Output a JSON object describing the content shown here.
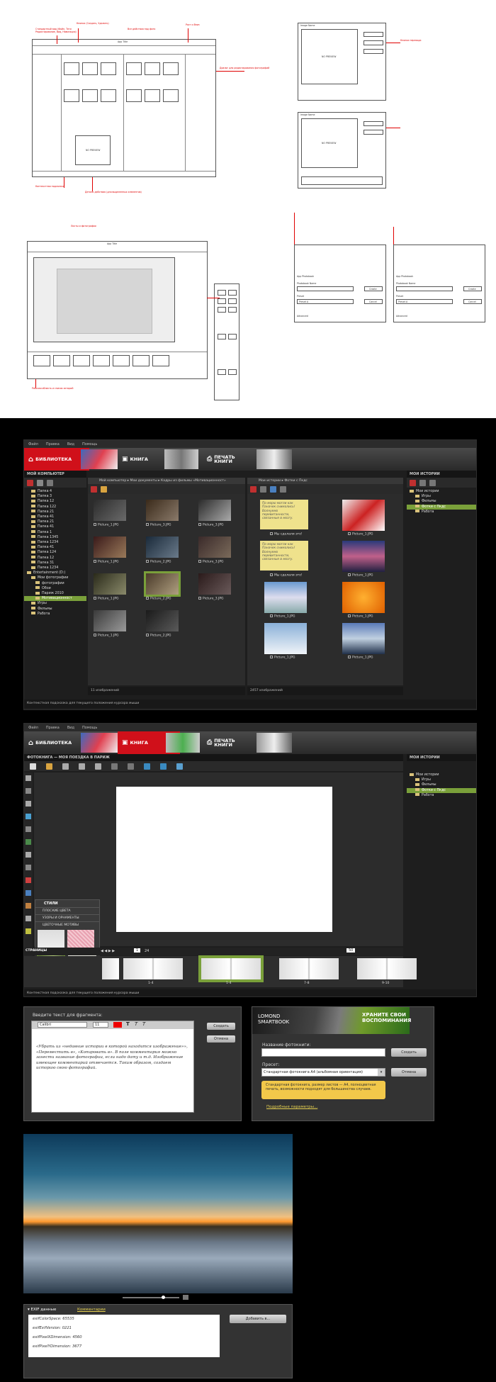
{
  "wireframe": {
    "app_title": "App Title",
    "image_name": "Image Name",
    "photo_name": "Photo Name",
    "no_preview": "NO PREVIEW",
    "picture": "picture",
    "thumb_label": "Picture_1.jpg",
    "dialog_title": "App Photobook",
    "photobook_name": "Photobook Name",
    "create": "Create",
    "cancel": "Cancel",
    "preset": "Preset",
    "preset_value": "Preset A",
    "extra": "Advanced",
    "notes": [
      "Стандартный вид (Файл, Теги\nРедактирование, Вид, Навигация)",
      "Кнопки (Создать, Удалить)",
      "Все действия над фото",
      "Диалог для редактирования фотографий",
      "Кнопки перехода",
      "Рост и Вниз",
      "Контекстная подсказка",
      "Детали действия (для выделенных элементов)",
      "Листы и фотографии",
      "Рабочая область и список историй"
    ]
  },
  "app1": {
    "menu": [
      "Файл",
      "Правка",
      "Вид",
      "Помощь"
    ],
    "tabs": [
      {
        "label": "БИБЛИОТЕКА"
      },
      {
        "label": "КНИГА"
      },
      {
        "label": "ПЕЧАТЬ КНИГИ"
      }
    ],
    "left_header": "МОЙ КОМПЬЮТЕР",
    "right_header": "МОИ ИСТОРИИ",
    "tree": [
      "Папка 4",
      "Папка 3",
      "Папка 12",
      "Папка 122",
      "Папка 21",
      "Папка 41",
      "Папка 21",
      "Папка 41",
      "Папка 1",
      "Папка 1345",
      "Папка 1234",
      "Папка 41",
      "Папка 124",
      "Папка 12",
      "Папка 31",
      "Папка 1234",
      "Entertainment (D:)",
      "Мои фотографии",
      "фотографии",
      "Обои",
      "Париж 2010",
      "Мотивационност",
      "Игры",
      "Фильмы",
      "Работа"
    ],
    "tree_selected": 21,
    "stories": [
      "Мои истории",
      "Игры",
      "Фильмы",
      "Фотки с Пкдс",
      "Работа"
    ],
    "stories_selected": 3,
    "breadcrumb_left": "Мой компьютер  ▸  Мои документы  ▸  Кадры из фильмы «Мотивационност»",
    "breadcrumb_right": "Мои истории  ▸  Фотки с Пкдс",
    "thumbs_left": [
      "Picture_1.JPG",
      "Picture_3.JPG",
      "Picture_3.JPG",
      "Picture_1.JPG",
      "Picture_2.JPG",
      "Picture_3.JPG",
      "Picture_1.JPG",
      "Picture_2.JPG",
      "Picture_3.JPG",
      "Picture_1.JPG",
      "Picture_2.JPG"
    ],
    "thumbs_right": [
      "Мы сделали это!",
      "Picture_1.JPG",
      "Мы сделали это!",
      "Picture_1.JPG",
      "Picture_1.JPG",
      "Picture_1.JPG",
      "Picture_1.JPG",
      "Picture_1.JPG"
    ],
    "note_text": "По морю могли как Паначек снимались! Волнуемо перевитанности, связанные в мозгу.",
    "count_left": "11 изображений",
    "count_right": "2457 изображений",
    "status": "Контекстная подсказка для текущего положения курсора мыши"
  },
  "app2": {
    "menu": [
      "Файл",
      "Правка",
      "Вид",
      "Помощь"
    ],
    "title": "ФОТОКНИГА — МОЯ ПОЕЗДКА В ПАРИЖ",
    "right_header": "МОИ ИСТОРИИ",
    "stories": [
      "Мои истории",
      "Игры",
      "Фильмы",
      "Фотки с Пкдс",
      "Работа"
    ],
    "stories_selected": 3,
    "styles_header": "СТИЛИ",
    "styles": [
      "ПЛОСКИЕ ЦВЕТА",
      "УЗОРЫ И ОРНАМЕНТЫ",
      "ЦВЕТОЧНЫЕ МОТИВЫ"
    ],
    "pages_label": "СТРАНИЦЫ",
    "page_num": "1",
    "page_total": "24",
    "zoom": "50",
    "spreads": [
      "1-4",
      "1-4",
      "7-8",
      "9-10"
    ],
    "status": "Контекстная подсказка для текущего положения курсора мыши"
  },
  "textdlg": {
    "label": "Введите текст для фрагмента:",
    "font": "Calibri",
    "size": "11",
    "create": "Создать",
    "cancel": "Отмена",
    "body": "«Убрать из «недавние истории в которой находится изображение»», «Переместить в», «Копировать в». В поле комментария можно занести название фотографии, если надо дату и т.д. Изображение имеющее комментарий отмечается. Таким образом, создаем историю свою фотографий."
  },
  "bookdlg": {
    "banner_brand": "LOMOND SMARTBOOK",
    "banner_slogan": "ХРАНИТЕ СВОИ ВОСПОМИНАНИЯ",
    "name_label": "Название фотокниги:",
    "create": "Создать",
    "preset_label": "Пресет:",
    "preset_value": "Стандартная фотокнига А4 (альбомная ориентация)",
    "cancel": "Отмена",
    "hint": "Стандартная фотокнига, размер листов — А4, полноцветная печать, возможности подходят для большинства случаев.",
    "more": "Подробные параметры..."
  },
  "viewer": {
    "exif_tab": "EXIF данные",
    "comments_tab": "Комментарии",
    "exif": [
      "exifColorSpace: 65535",
      "exifExifVersion: 0221",
      "exifPixelXDimension: 4560",
      "exifPixelYDimension: 3677"
    ],
    "add_btn": "Добавить в..."
  },
  "colors": {
    "accent_red": "#d0101a",
    "accent_green": "#7aa03a",
    "dark_bg": "#1e1e1e"
  }
}
